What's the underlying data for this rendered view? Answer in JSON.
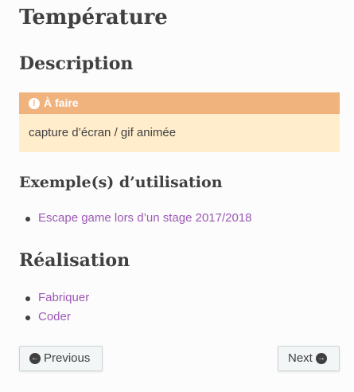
{
  "page": {
    "title": "Température"
  },
  "description": {
    "heading": "Description",
    "admonition": {
      "icon": "exclamation-circle-icon",
      "title": "À faire",
      "body": "capture d’écran / gif animée",
      "title_bg": "#f0b37e",
      "body_bg": "#ffedcc"
    }
  },
  "examples": {
    "heading": "Exemple(s) d’utilisation",
    "items": [
      {
        "label": "Escape game lors d’un stage 2017/2018"
      }
    ]
  },
  "realisation": {
    "heading": "Réalisation",
    "items": [
      {
        "label": "Fabriquer"
      },
      {
        "label": "Coder"
      }
    ]
  },
  "navigation": {
    "previous": {
      "label": "Previous",
      "icon": "arrow-circle-left-icon"
    },
    "next": {
      "label": "Next",
      "icon": "arrow-circle-right-icon"
    }
  },
  "colors": {
    "link": "#9b59b6",
    "text": "#404040",
    "background": "#fcfcfc"
  }
}
